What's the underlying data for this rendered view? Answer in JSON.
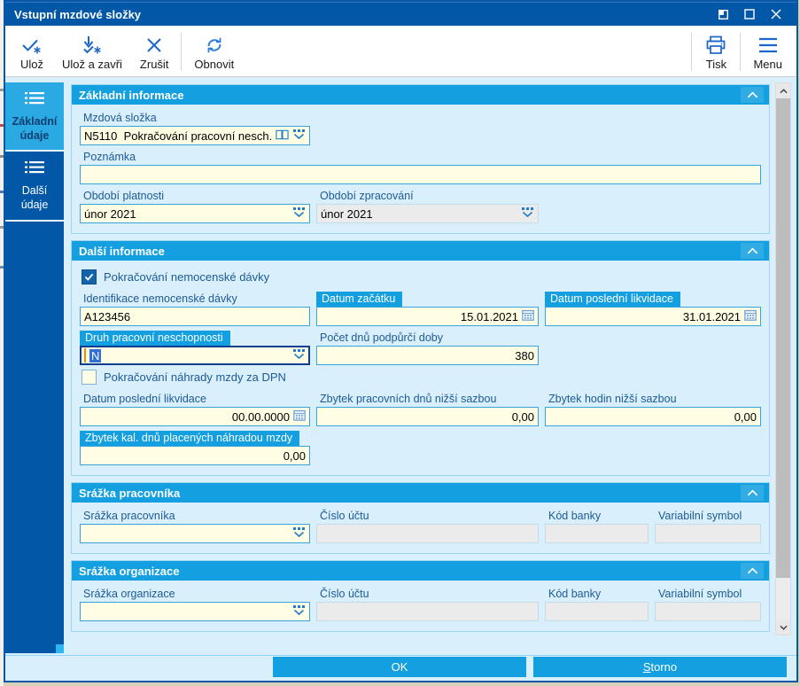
{
  "window": {
    "title": "Vstupní mzdové složky"
  },
  "toolbar": {
    "save": {
      "label": "Ulož",
      "icon": "save-check-asterisk-icon"
    },
    "save_close": {
      "label": "Ulož a zavři",
      "icon": "save-close-arrow-icon"
    },
    "cancel": {
      "label": "Zrušit",
      "icon": "cancel-x-icon"
    },
    "refresh": {
      "label": "Obnovit",
      "icon": "refresh-arrows-icon"
    },
    "print": {
      "label": "Tisk",
      "icon": "printer-icon"
    },
    "menu": {
      "label": "Menu",
      "icon": "hamburger-icon"
    }
  },
  "sidebar": {
    "tabs": [
      {
        "label": "Základní údaje",
        "active": true,
        "icon": "list-icon"
      },
      {
        "label": "Další údaje",
        "active": false,
        "icon": "list-icon"
      }
    ]
  },
  "sections": {
    "zakladni": {
      "title": "Základní informace",
      "mzdova_slozka": {
        "label": "Mzdová složka",
        "value": "N5110  Pokračování pracovní nesch."
      },
      "poznamka": {
        "label": "Poznámka",
        "value": ""
      },
      "obdobi_platnosti": {
        "label": "Období platnosti",
        "value": "únor 2021"
      },
      "obdobi_zpracovani": {
        "label": "Období zpracování",
        "value": "únor 2021",
        "disabled": true
      }
    },
    "dalsi": {
      "title": "Další informace",
      "pokracovani_davky": {
        "label": "Pokračování nemocenské dávky",
        "checked": true
      },
      "identifikace": {
        "label": "Identifikace nemocenské dávky",
        "value": "A123456"
      },
      "datum_zacatku": {
        "label": "Datum začátku",
        "value": "15.01.2021",
        "highlighted": true
      },
      "datum_likvidace": {
        "label": "Datum poslední likvidace",
        "value": "31.01.2021",
        "highlighted": true
      },
      "druh_neschopnosti": {
        "label": "Druh pracovní neschopnosti",
        "value": "N",
        "highlighted": true,
        "focused": true
      },
      "pocet_dnu": {
        "label": "Počet dnů podpůrčí doby",
        "value": "380"
      },
      "pokracovani_nahrady": {
        "label": "Pokračování náhrady mzdy za DPN",
        "checked": false
      },
      "datum_likvidace2": {
        "label": "Datum poslední likvidace",
        "value": "00.00.0000"
      },
      "zbytek_dnu": {
        "label": "Zbytek pracovních dnů nižší sazbou",
        "value": "0,00"
      },
      "zbytek_hodin": {
        "label": "Zbytek hodin nižší sazbou",
        "value": "0,00"
      },
      "zbytek_kal_dnu": {
        "label": "Zbytek kal. dnů placených náhradou mzdy",
        "value": "0,00",
        "highlighted": true
      }
    },
    "srazka_pracovnika": {
      "title": "Srážka pracovníka",
      "srazka": {
        "label": "Srážka pracovníka",
        "value": ""
      },
      "cislo_uctu": {
        "label": "Číslo účtu",
        "value": "",
        "disabled": true
      },
      "kod_banky": {
        "label": "Kód banky",
        "value": "",
        "disabled": true
      },
      "variabilni_symbol": {
        "label": "Variabilní symbol",
        "value": "",
        "disabled": true
      }
    },
    "srazka_organizace": {
      "title": "Srážka organizace",
      "srazka": {
        "label": "Srážka organizace",
        "value": ""
      },
      "cislo_uctu": {
        "label": "Číslo účtu",
        "value": "",
        "disabled": true
      },
      "kod_banky": {
        "label": "Kód banky",
        "value": "",
        "disabled": true
      },
      "variabilni_symbol": {
        "label": "Variabilní symbol",
        "value": "",
        "disabled": true
      }
    }
  },
  "footer": {
    "ok": "OK",
    "storno_accel": "S",
    "storno_rest": "torno"
  },
  "colors": {
    "titlebar": "#0257a7",
    "section_header": "#14a0e0",
    "active_tab": "#2aa9e2",
    "content_bg": "#d9effc",
    "input_bg": "#fffde3",
    "input_border": "#35a3dd",
    "disabled_bg": "#ebebeb",
    "focus_border": "#0b3d91",
    "selection": "#2f6fd6",
    "icon_blue": "#1b66c9",
    "label_text": "#1d5a96"
  }
}
